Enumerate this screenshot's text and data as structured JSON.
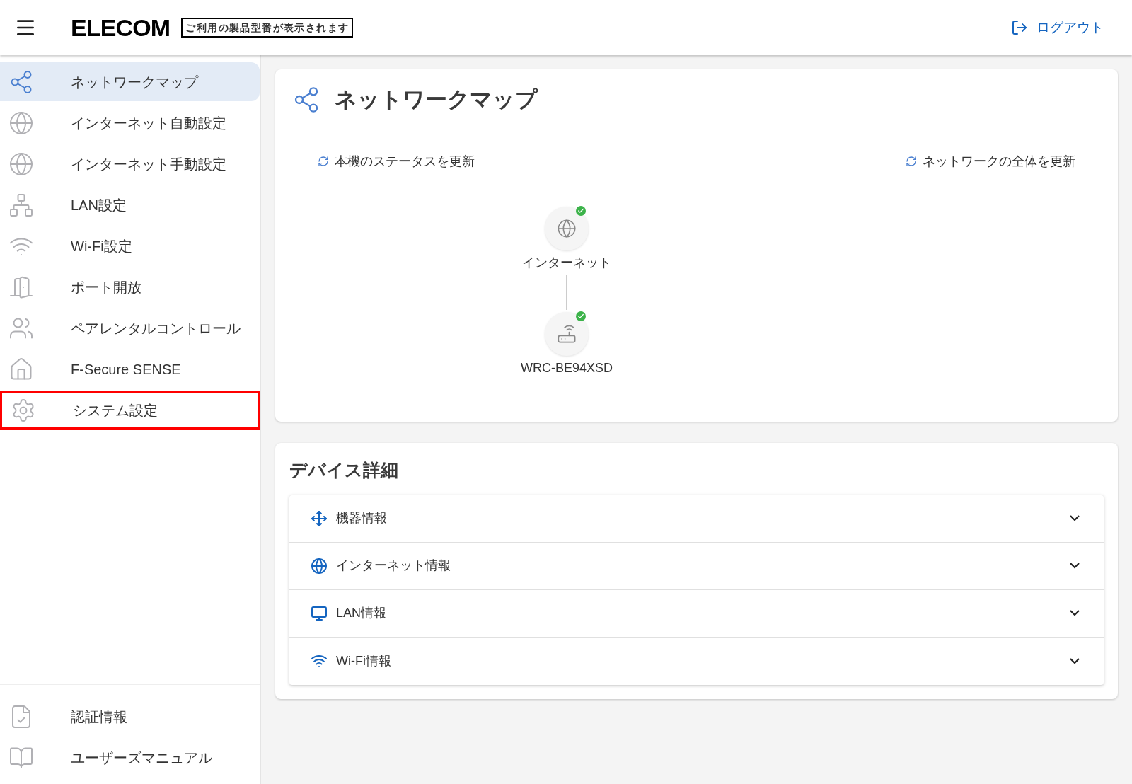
{
  "header": {
    "logo": "ELECOM",
    "model_label": "ご利用の製品型番が表示されます",
    "logout": "ログアウト"
  },
  "sidebar": {
    "items": [
      {
        "kind": "share",
        "label": "ネットワークマップ",
        "selected": true,
        "highlighted": false
      },
      {
        "kind": "globe-auto",
        "label": "インターネット自動設定",
        "selected": false,
        "highlighted": false
      },
      {
        "kind": "globe-manual",
        "label": "インターネット手動設定",
        "selected": false,
        "highlighted": false
      },
      {
        "kind": "lan",
        "label": "LAN設定",
        "selected": false,
        "highlighted": false
      },
      {
        "kind": "wifi",
        "label": "Wi-Fi設定",
        "selected": false,
        "highlighted": false
      },
      {
        "kind": "door",
        "label": "ポート開放",
        "selected": false,
        "highlighted": false
      },
      {
        "kind": "family",
        "label": "ペアレンタルコントロール",
        "selected": false,
        "highlighted": false
      },
      {
        "kind": "shield-house",
        "label": "F-Secure SENSE",
        "selected": false,
        "highlighted": false
      },
      {
        "kind": "gear",
        "label": "システム設定",
        "selected": false,
        "highlighted": true
      }
    ],
    "footer_items": [
      {
        "kind": "certificate",
        "label": "認証情報"
      },
      {
        "kind": "book",
        "label": "ユーザーズマニュアル"
      }
    ]
  },
  "network_map": {
    "title": "ネットワークマップ",
    "refresh_device": "本機のステータスを更新",
    "refresh_all": "ネットワークの全体を更新",
    "nodes": [
      {
        "kind": "internet",
        "label": "インターネット",
        "ok": true
      },
      {
        "kind": "router",
        "label": "WRC-BE94XSD",
        "ok": true
      }
    ]
  },
  "device_details": {
    "title": "デバイス詳細",
    "sections": [
      {
        "kind": "device",
        "label": "機器情報",
        "expanded": false
      },
      {
        "kind": "internet",
        "label": "インターネット情報",
        "expanded": false
      },
      {
        "kind": "lan",
        "label": "LAN情報",
        "expanded": false
      },
      {
        "kind": "wifi",
        "label": "Wi-Fi情報",
        "expanded": false
      }
    ]
  }
}
